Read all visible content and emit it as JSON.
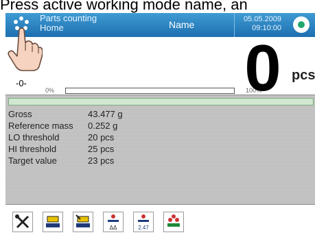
{
  "instruction": "Press active working mode name, an",
  "header": {
    "mode_title": "Parts counting",
    "mode_subtitle": "Home",
    "user_name": "Name",
    "date": "05.05.2009",
    "time": "09:10:00",
    "status_color": "#1fa76e",
    "accent": "#2a86c6"
  },
  "weighing": {
    "zero_indicator": "-0-",
    "bar_min_label": "0%",
    "bar_max_label": "100%",
    "bar_level": 0,
    "value": "0",
    "unit": "pcs"
  },
  "info": {
    "rows": [
      {
        "label": "Gross",
        "value": "43.477 g"
      },
      {
        "label": "Reference mass",
        "value": "0.252 g"
      },
      {
        "label": "LO threshold",
        "value": "20 pcs"
      },
      {
        "label": "HI threshold",
        "value": "25 pcs"
      },
      {
        "label": "Target value",
        "value": "23 pcs"
      }
    ]
  },
  "toolbar": {
    "buttons": [
      {
        "icon": "tools-icon"
      },
      {
        "icon": "tare-icon"
      },
      {
        "icon": "tare-set-icon"
      },
      {
        "icon": "reference-mass-icon"
      },
      {
        "icon": "unit-mass-icon",
        "label": "2.47"
      },
      {
        "icon": "parts-icon"
      }
    ]
  }
}
